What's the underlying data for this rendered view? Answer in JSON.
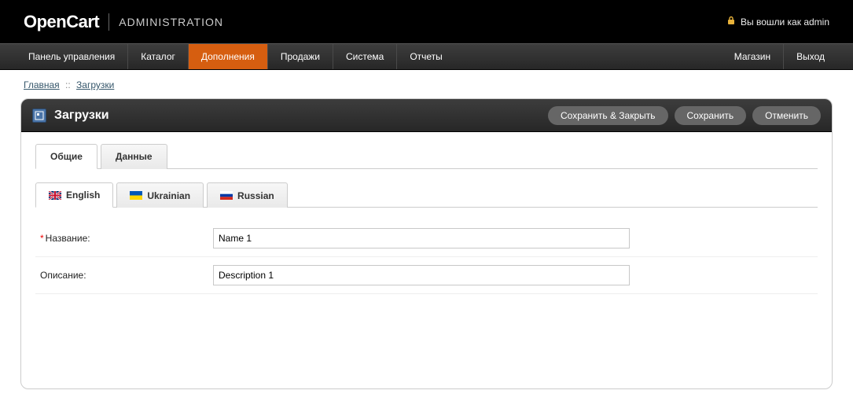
{
  "header": {
    "logo": "OpenCart",
    "section": "ADMINISTRATION",
    "login_text": "Вы вошли как admin"
  },
  "nav": {
    "left": [
      {
        "label": "Панель управления"
      },
      {
        "label": "Каталог"
      },
      {
        "label": "Дополнения",
        "active": true
      },
      {
        "label": "Продажи"
      },
      {
        "label": "Система"
      },
      {
        "label": "Отчеты"
      }
    ],
    "right": [
      {
        "label": "Магазин"
      },
      {
        "label": "Выход"
      }
    ]
  },
  "breadcrumb": {
    "home": "Главная",
    "current": "Загрузки"
  },
  "page": {
    "title": "Загрузки",
    "buttons": {
      "save_close": "Сохранить & Закрыть",
      "save": "Сохранить",
      "cancel": "Отменить"
    },
    "tabs": {
      "general": "Общие",
      "data": "Данные"
    },
    "lang_tabs": {
      "en": "English",
      "uk": "Ukrainian",
      "ru": "Russian"
    },
    "form": {
      "name_label": "Название:",
      "name_value": "Name 1",
      "desc_label": "Описание:",
      "desc_value": "Description 1"
    }
  }
}
